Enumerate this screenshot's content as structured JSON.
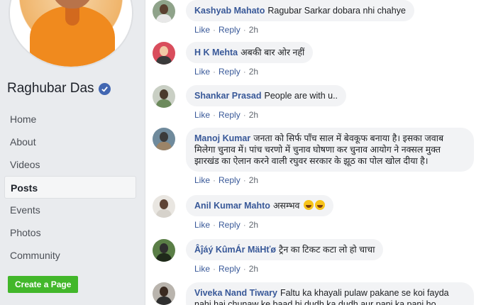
{
  "sidebar": {
    "page_name": "Raghubar Das",
    "nav": [
      {
        "label": "Home"
      },
      {
        "label": "About"
      },
      {
        "label": "Videos"
      },
      {
        "label": "Posts"
      },
      {
        "label": "Events"
      },
      {
        "label": "Photos"
      },
      {
        "label": "Community"
      }
    ],
    "create_page_label": "Create a Page"
  },
  "comment_actions": {
    "like": "Like",
    "reply": "Reply",
    "separator": "·"
  },
  "comments": [
    {
      "author": "Kashyab Mahato",
      "text": "Ragubar Sarkar dobara nhi chahye",
      "time": "2h"
    },
    {
      "author": "H K Mehta",
      "text": "अबकी बार ओर नहीं",
      "time": "2h"
    },
    {
      "author": "Shankar Prasad",
      "text": "People are with u..",
      "time": "2h"
    },
    {
      "author": "Manoj Kumar",
      "text": "जनता को सिर्फ पाँच साल में बेवकूफ बनाया है। इसका जवाब मिलेगा चुनाव में। पांच चरणो में चुनाव घोषणा कर चुनाव आयोग ने नक्सल मुक्त झारखंड का ऐलान करने वाली रघुवर सरकार के झूठ का पोल खोल दीया है।",
      "time": "2h"
    },
    {
      "author": "Anil Kumar Mahto",
      "text": "असम्भव",
      "time": "2h"
    },
    {
      "author": "Âĵáý KûmÁr MäHťø",
      "text": "ट्रैन का टिकट कटा लो हो चाचा",
      "time": "2h"
    },
    {
      "author": "Viveka Nand Tiwary",
      "text": "Faltu ka khayali pulaw pakane se koi fayda nahi hai chunaw ke baad hi dudh ka dudh aur pani ka pani ho",
      "time": ""
    }
  ]
}
